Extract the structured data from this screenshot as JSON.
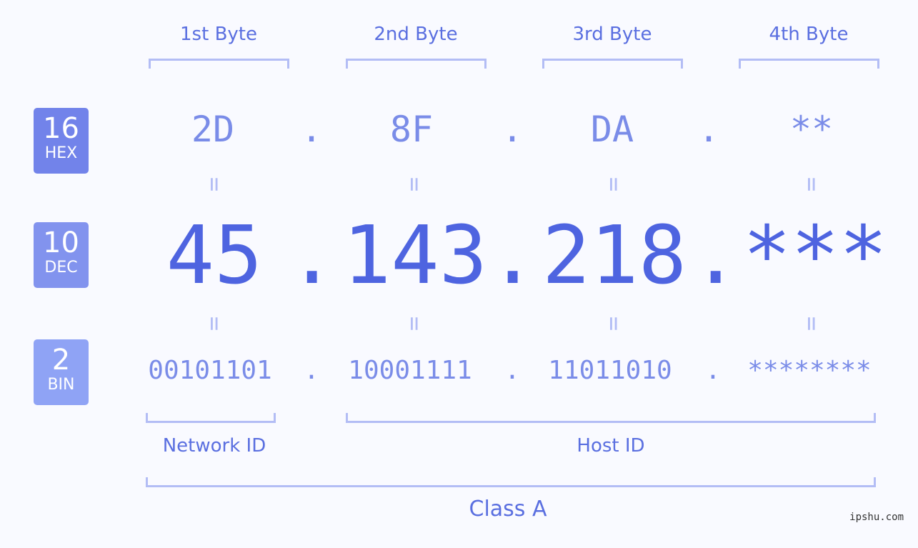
{
  "bytes": [
    {
      "label": "1st Byte",
      "hex": "2D",
      "dec": "45",
      "bin": "00101101"
    },
    {
      "label": "2nd Byte",
      "hex": "8F",
      "dec": "143",
      "bin": "10001111"
    },
    {
      "label": "3rd Byte",
      "hex": "DA",
      "dec": "218",
      "bin": "11011010"
    },
    {
      "label": "4th Byte",
      "hex": "**",
      "dec": "***",
      "bin": "********"
    }
  ],
  "separator": ".",
  "equals": "=",
  "badges": {
    "hex": {
      "num": "16",
      "label": "HEX",
      "color": "#7283ea"
    },
    "dec": {
      "num": "10",
      "label": "DEC",
      "color": "#8293ee"
    },
    "bin": {
      "num": "2",
      "label": "BIN",
      "color": "#8fa3f5"
    }
  },
  "groups": {
    "network": "Network ID",
    "host": "Host ID",
    "class": "Class A"
  },
  "watermark": "ipshu.com",
  "colors": {
    "accent": "#4e64e0",
    "light": "#7a8ce8",
    "bracket": "#b3bdf5",
    "background": "#f9faff"
  }
}
